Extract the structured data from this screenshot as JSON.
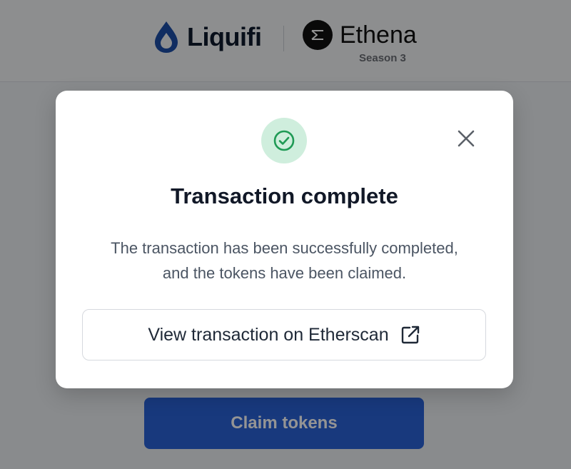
{
  "header": {
    "brand_primary": "Liquifi",
    "brand_partner": "Ethena",
    "partner_subtitle": "Season 3"
  },
  "main": {
    "claim_button_label": "Claim tokens"
  },
  "modal": {
    "title": "Transaction complete",
    "message_line1": "The transaction has been successfully completed,",
    "message_line2": "and the tokens have been claimed.",
    "etherscan_button_label": "View transaction on Etherscan",
    "icons": {
      "status": "check-circle-icon",
      "close": "close-icon",
      "external": "external-link-icon"
    }
  },
  "colors": {
    "brand_blue": "#1d4ea8",
    "claim_button": "#2a62d8",
    "success_green": "#1f9a55",
    "success_bg": "#cfeedd",
    "overlay": "rgba(0,0,0,0.42)"
  }
}
